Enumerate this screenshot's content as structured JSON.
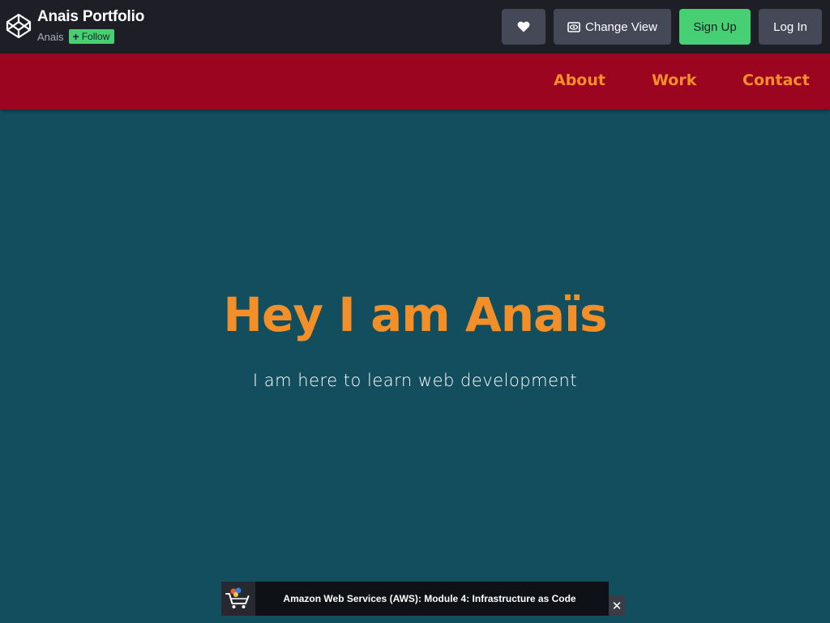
{
  "header": {
    "title": "Anais Portfolio",
    "author": "Anais",
    "follow_label": "Follow",
    "change_view_label": "Change View",
    "signup_label": "Sign Up",
    "login_label": "Log In",
    "icons": {
      "logo": "codepen-logo-icon",
      "heart": "heart-icon",
      "view": "eye-icon",
      "follow": "plus-icon"
    }
  },
  "nav": {
    "items": [
      {
        "label": "About"
      },
      {
        "label": "Work"
      },
      {
        "label": "Contact"
      }
    ]
  },
  "hero": {
    "title": "Hey I am Anaïs",
    "subtitle": "I am here to learn web development"
  },
  "ad": {
    "text": "Amazon Web Services (AWS): Module 4: Infrastructure as Code",
    "icon": "cart-icon",
    "close_label": "✕"
  },
  "colors": {
    "header_bg": "#1e1f26",
    "button_bg": "#444857",
    "signup_bg": "#47cf73",
    "nav_bg": "#9b0520",
    "accent": "#f28f28",
    "page_bg": "#124e5e"
  }
}
